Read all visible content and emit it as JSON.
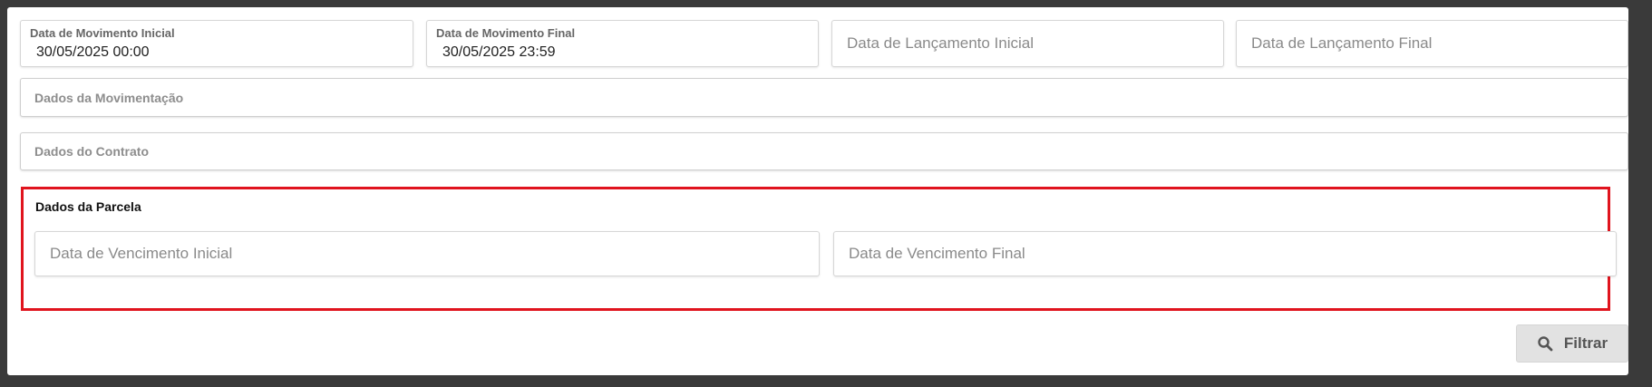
{
  "filters": {
    "movimento_inicial": {
      "label": "Data de Movimento Inicial",
      "value": "30/05/2025 00:00"
    },
    "movimento_final": {
      "label": "Data de Movimento Final",
      "value": "30/05/2025 23:59"
    },
    "lancamento_inicial": {
      "placeholder": "Data de Lançamento Inicial"
    },
    "lancamento_final": {
      "placeholder": "Data de Lançamento Final"
    }
  },
  "sections": {
    "movimentacao": "Dados da Movimentação",
    "contrato": "Dados do Contrato",
    "parcela": {
      "title": "Dados da Parcela",
      "vencimento_inicial": {
        "placeholder": "Data de Vencimento Inicial"
      },
      "vencimento_final": {
        "placeholder": "Data de Vencimento Final"
      }
    }
  },
  "actions": {
    "filter_label": "Filtrar",
    "filter_icon": "search-icon"
  },
  "colors": {
    "highlight_border": "#e0141e",
    "button_bg": "#e2e2e2"
  }
}
